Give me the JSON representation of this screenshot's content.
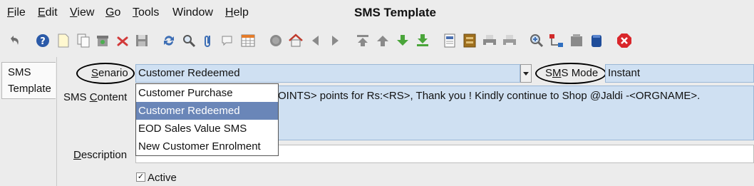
{
  "window": {
    "title": "SMS Template"
  },
  "menu": {
    "file": "File",
    "edit": "Edit",
    "view": "View",
    "go": "Go",
    "tools": "Tools",
    "window": "Window",
    "help": "Help"
  },
  "toolbar": {
    "icons": [
      "undo-icon",
      "help-icon",
      "new-icon",
      "copy-icon",
      "archive-icon",
      "delete-icon",
      "save-icon",
      "refresh-icon",
      "find-icon",
      "attach-icon",
      "chat-icon",
      "grid-icon",
      "history-icon",
      "home-icon",
      "back-icon",
      "forward-icon",
      "first-icon",
      "prev-icon",
      "next-icon",
      "last-icon",
      "report-icon",
      "archive-2-icon",
      "print-icon",
      "print-preview-icon",
      "zoom-icon",
      "workflow-icon",
      "product-icon",
      "request-icon",
      "exit-icon"
    ]
  },
  "side_tab": {
    "line1": "SMS",
    "line2": "Template"
  },
  "form": {
    "senario": {
      "label": "Senario",
      "value": "Customer Redeemed"
    },
    "sms_mode": {
      "label": "SMS Mode",
      "value": "Instant"
    },
    "sms_content": {
      "label": "SMS Content",
      "value_visible": "OINTS>  points for Rs:<RS>, Thank you ! Kindly continue to Shop @Jaldi -<ORGNAME>."
    },
    "description": {
      "label": "Description",
      "value": ""
    },
    "active": {
      "label": "Active",
      "checked": true
    }
  },
  "dropdown": {
    "options": [
      "Customer Purchase",
      "Customer Redeemed",
      "EOD Sales Value SMS",
      "New Customer Enrolment"
    ],
    "selected_index": 1
  },
  "colors": {
    "field_bg": "#cfe0f2",
    "selection": "#6a86b8",
    "window_bg": "#ececec",
    "exit_red": "#d9262b"
  }
}
